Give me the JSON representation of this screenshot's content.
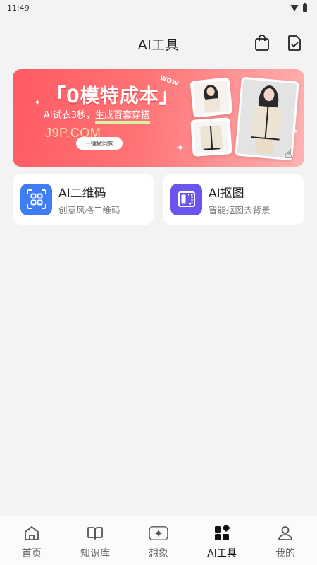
{
  "status_bar": {
    "time": "11:49"
  },
  "header": {
    "title": "AI工具",
    "actions": [
      "shopping-bag-icon",
      "document-check-icon"
    ]
  },
  "banner": {
    "headline": "「0模特成本」",
    "subtitle_prefix": "AI试衣3秒，",
    "subtitle_highlight": "生成百套穿搭",
    "button_label": "一键做同款",
    "wow_text": "WOW",
    "watermark": "J9P.COM",
    "accent_color": "#ff5a62"
  },
  "tools": [
    {
      "title": "AI二维码",
      "description": "创意风格二维码",
      "icon": "qr-code-icon",
      "icon_color": "#3f7cf5"
    },
    {
      "title": "AI抠图",
      "description": "智能抠图去背景",
      "icon": "cutout-icon",
      "icon_color": "#6a55ee"
    }
  ],
  "nav": {
    "items": [
      {
        "label": "首页",
        "icon": "home-icon"
      },
      {
        "label": "知识库",
        "icon": "book-icon"
      },
      {
        "label": "想象",
        "icon": "sparkle-icon"
      },
      {
        "label": "AI工具",
        "icon": "grid-icon",
        "active": true
      },
      {
        "label": "我的",
        "icon": "user-icon"
      }
    ]
  }
}
